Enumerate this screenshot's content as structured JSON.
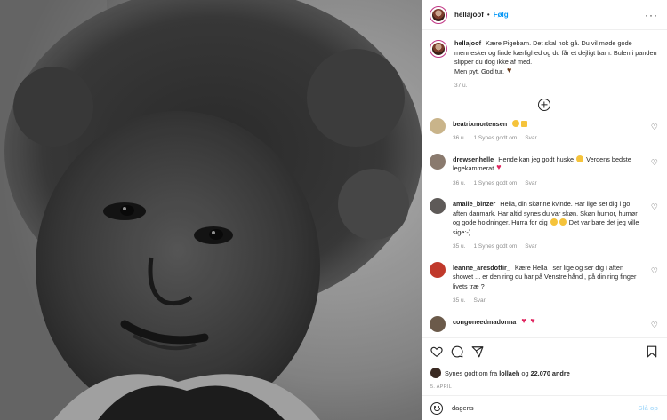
{
  "post": {
    "username": "hellajoof",
    "follow_label": "Følg",
    "separator": "•",
    "more_label": "···"
  },
  "caption": {
    "username": "hellajoof",
    "text": "Kære Pigebarn. Det skal nok gå. Du vil møde gode mennesker og finde kærlighed og du får et dejligt barn. Bulen i panden slipper du dog ikke af med.",
    "text2": "Men pyt. God tur.",
    "age": "37 u."
  },
  "comments": [
    {
      "username": "beatrixmortensen",
      "text": "",
      "age": "36 u.",
      "likes": "1 Synes godt om",
      "reply": "Svar",
      "avatar_color": "#c9b48a"
    },
    {
      "username": "drewsenhelle",
      "text": "Hende kan jeg godt huske",
      "text_b": "Verdens bedste legekammerat",
      "age": "36 u.",
      "likes": "1 Synes godt om",
      "reply": "Svar",
      "avatar_color": "#8a7a6e"
    },
    {
      "username": "amalie_binzer",
      "text": "Hella, din skønne kvinde. Har lige set dig i go aften danmark. Har altid synes du var skøn. Skøn humor, humør og gode holdninger. Hurra for dig",
      "text_b": "Det var bare det jeg ville sige:-)",
      "age": "35 u.",
      "likes": "1 Synes godt om",
      "reply": "Svar",
      "avatar_color": "#5e5a58"
    },
    {
      "username": "leanne_aresdottir_",
      "text": "Kære Hella , ser lige og ser dig i aften showet ... er den ring du har på Venstre hånd , på din ring finger , livets træ ?",
      "age": "35 u.",
      "reply": "Svar",
      "avatar_color": "#c0392b"
    },
    {
      "username": "congoneedmadonna",
      "text": "",
      "age": "",
      "avatar_color": "#6b5a4a"
    }
  ],
  "likes_line": {
    "prefix": "Synes godt om fra",
    "user": "lollaeh",
    "conj": "og",
    "count": "22.070 andre"
  },
  "date": "5. APRIL",
  "add_comment": {
    "placeholder": "dagens",
    "post_label": "Slå op"
  },
  "colors": {
    "accent": "#0095f6",
    "text": "#262626",
    "muted": "#8e8e8e",
    "heart": "#e0245e"
  },
  "icons": {
    "like": "heart-icon",
    "comment": "comment-icon",
    "share": "share-icon",
    "save": "bookmark-icon",
    "emoji": "smiley-icon",
    "load_more": "plus-circle-icon"
  }
}
